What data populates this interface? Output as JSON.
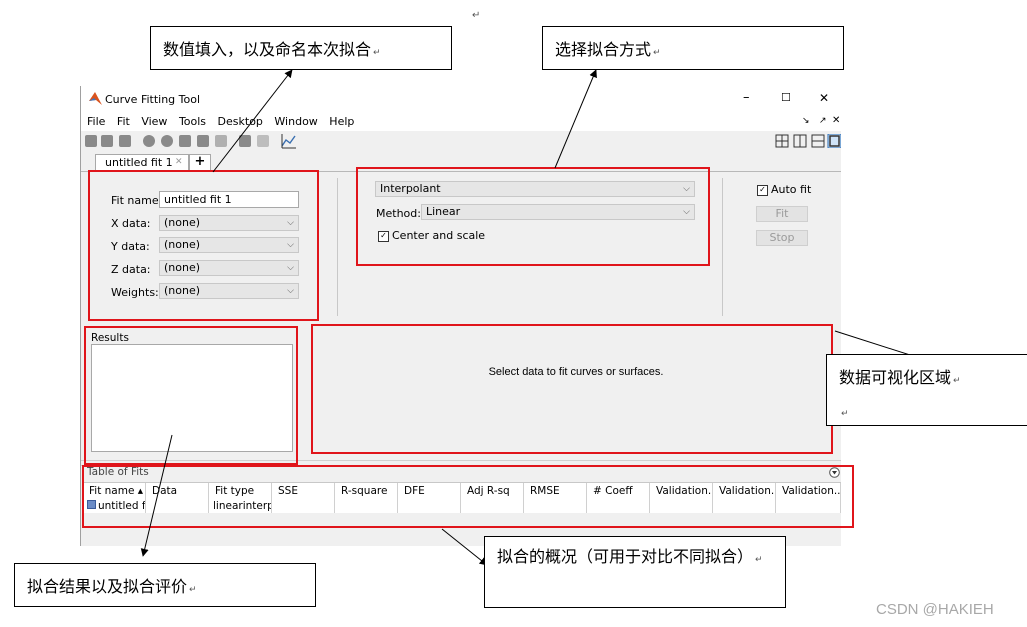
{
  "stray_return_mark": "↵",
  "window": {
    "title": "Curve Fitting Tool",
    "controls": {
      "minimize": "–",
      "maximize": "☐",
      "close": "✕"
    },
    "menu": [
      "File",
      "Fit",
      "View",
      "Tools",
      "Desktop",
      "Window",
      "Help"
    ],
    "menu_right": {
      "dock": "↘",
      "undock": "↗",
      "close": "✕"
    },
    "tab": {
      "label": "untitled fit 1",
      "close": "✕",
      "add": "+"
    },
    "data_panel": {
      "fit_name_label": "Fit name:",
      "fit_name_value": "untitled fit 1",
      "x_label": "X data:",
      "x_value": "(none)",
      "y_label": "Y data:",
      "y_value": "(none)",
      "z_label": "Z data:",
      "z_value": "(none)",
      "weights_label": "Weights:",
      "weights_value": "(none)"
    },
    "fit_panel": {
      "fit_type": "Interpolant",
      "method_label": "Method:",
      "method_value": "Linear",
      "center_scale_label": "Center and scale",
      "center_scale_checked": true
    },
    "actions": {
      "auto_fit_label": "Auto fit",
      "auto_fit_checked": true,
      "fit_button": "Fit",
      "stop_button": "Stop"
    },
    "results_label": "Results",
    "plot_message": "Select data to fit curves or surfaces.",
    "table": {
      "title": "Table of Fits",
      "headers": [
        "Fit name ▴",
        "Data",
        "Fit type",
        "SSE",
        "R-square",
        "DFE",
        "Adj R-sq",
        "RMSE",
        "# Coeff",
        "Validation...",
        "Validation...",
        "Validation..."
      ],
      "row": [
        "untitled f...",
        "",
        "linearinterp",
        "",
        "",
        "",
        "",
        "",
        "",
        "",
        "",
        ""
      ]
    }
  },
  "callouts": {
    "data_entry": "数值填入，以及命名本次拟合",
    "fit_method": "选择拟合方式",
    "visualization": "数据可视化区域",
    "results": "拟合结果以及拟合评价",
    "overview": "拟合的概况（可用于对比不同拟合）",
    "return_mark": "↵"
  },
  "watermark": "CSDN @HAKIEH",
  "colors": {
    "annotation_red": "#e0151b",
    "matlab_orange": "#d9531e"
  }
}
